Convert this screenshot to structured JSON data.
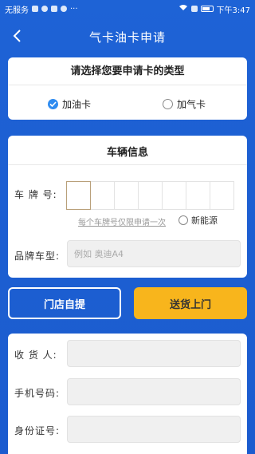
{
  "status_bar": {
    "left_text": "无服务",
    "time": "下午3:47"
  },
  "header": {
    "title": "气卡油卡申请"
  },
  "card_type": {
    "title": "请选择您要申请卡的类型",
    "options": [
      {
        "label": "加油卡",
        "selected": true
      },
      {
        "label": "加气卡",
        "selected": false
      }
    ]
  },
  "vehicle": {
    "title": "车辆信息",
    "plate_label": "车 牌 号:",
    "plate_slots": 7,
    "plate_hint": "每个车牌号仅限申请一次",
    "new_energy_label": "新能源",
    "brand_label": "品牌车型:",
    "brand_placeholder": "例如 奥迪A4"
  },
  "delivery": {
    "pickup_label": "门店自提",
    "delivery_label": "送货上门",
    "colors": {
      "delivery_bg": "#f8b51c",
      "accent": "#1d5fd2"
    }
  },
  "receiver": {
    "name_label": "收 货 人:",
    "phone_label": "手机号码:",
    "id_label": "身份证号:"
  },
  "icons": [
    "back-icon",
    "checkmark-icon",
    "battery-icon",
    "wifi-icon"
  ]
}
